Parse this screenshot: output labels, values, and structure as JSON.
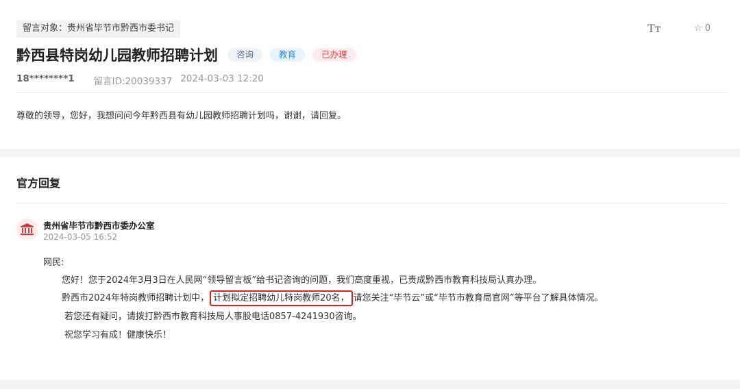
{
  "message": {
    "target": "留言对象：贵州省毕节市黔西市委书记",
    "font_size_icon": "Tт",
    "favorite_label": "☆ 0",
    "title": "黔西县特岗幼儿园教师招聘计划",
    "tags": [
      "咨询",
      "教育",
      "已办理"
    ],
    "user": "18********1",
    "message_id": "留言ID:20039337",
    "datetime": "2024-03-03 12:20",
    "content": "尊敬的领导，您好，我想问问今年黔西县有幼儿园教师招聘计划吗，谢谢，请回复。"
  },
  "reply": {
    "heading": "官方回复",
    "org_name": "贵州省毕节市黔西市委办公室",
    "datetime": "2024-03-05 16:52",
    "greeting": "网民:",
    "line1": "您好！您于2024年3月3日在人民网“领导留言板”给书记咨询的问题，我们高度重视，已责成黔西市教育科技局认真办理。",
    "line2_pre": "黔西市2024年特岗教师招聘计划中，",
    "line2_highlight": "计划拟定招聘幼儿特岗教师20名，",
    "line2_post": "请您关注“毕节云”或“毕节市教育局官网”等平台了解具体情况。",
    "line3": "若您还有疑问，请拨打黔西市教育科技局人事股电话0857-4241930咨询。",
    "line4": "祝您学习有成！健康快乐！"
  },
  "colors": {
    "tag_red": "#e8454a",
    "tag_blue": "#2d8fe6",
    "highlight_border": "#e21f1f",
    "avatar_bg": "#fdecec",
    "avatar_icon": "#d9363e"
  },
  "icons": {
    "font_size": "font-size-icon",
    "favorite": "star-outline-icon",
    "org": "government-building-icon"
  }
}
